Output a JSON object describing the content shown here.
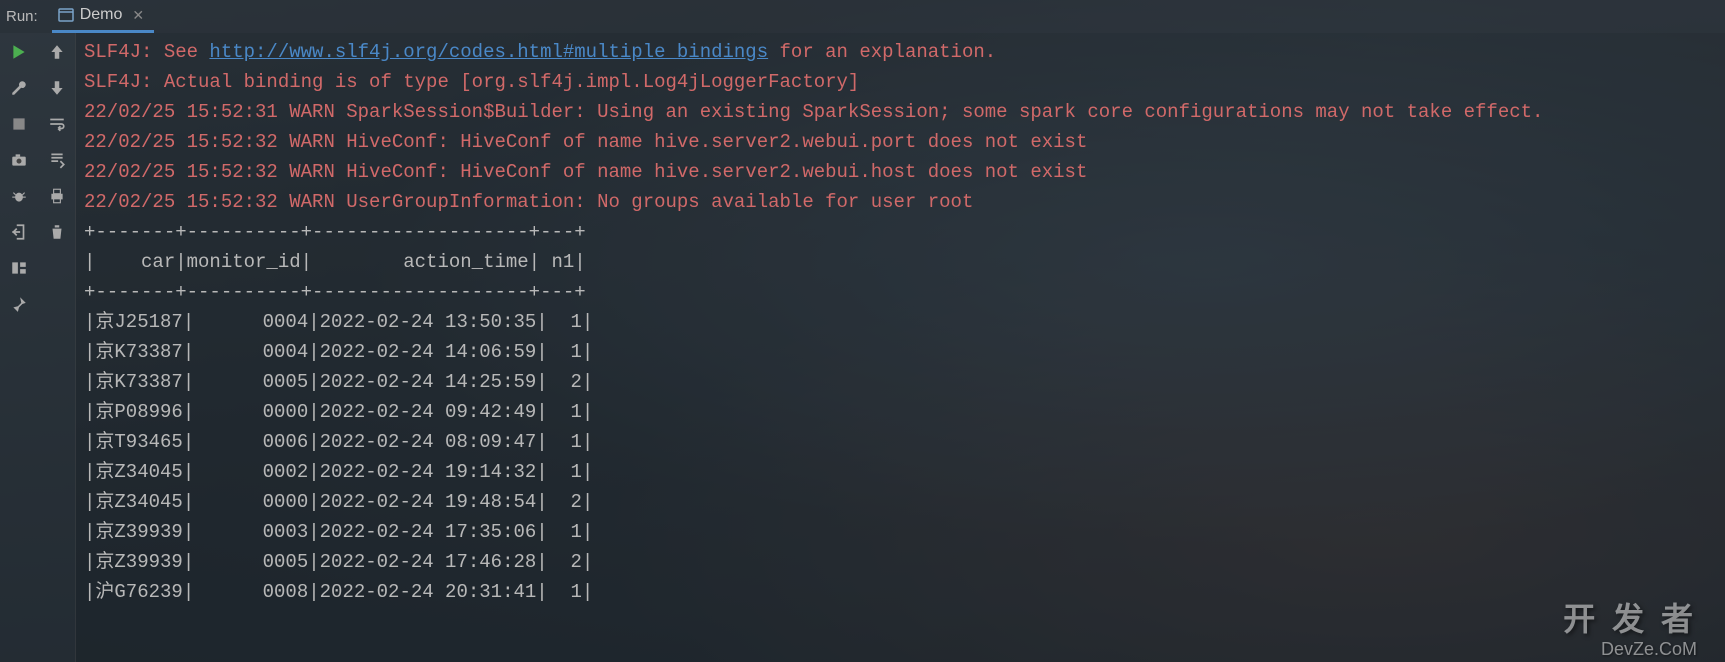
{
  "topbar": {
    "label": "Run:",
    "tab": {
      "name": "Demo"
    }
  },
  "sidebar1": {
    "run": "run",
    "wrench": "wrench",
    "stop": "stop",
    "camera": "camera",
    "bug": "bug",
    "exit": "exit",
    "layout": "layout",
    "pin": "pin"
  },
  "sidebar2": {
    "up": "up",
    "down": "down",
    "wrap": "wrap",
    "scroll": "scroll",
    "print": "print",
    "trash": "trash"
  },
  "console": {
    "log_prefix_1": "SLF4J: See ",
    "log_link_1": "http://www.slf4j.org/codes.html#multiple_bindings",
    "log_suffix_1": " for an explanation.",
    "log_2": "SLF4J: Actual binding is of type [org.slf4j.impl.Log4jLoggerFactory]",
    "log_3": "22/02/25 15:52:31 WARN SparkSession$Builder: Using an existing SparkSession; some spark core configurations may not take effect.",
    "log_4": "22/02/25 15:52:32 WARN HiveConf: HiveConf of name hive.server2.webui.port does not exist",
    "log_5": "22/02/25 15:52:32 WARN HiveConf: HiveConf of name hive.server2.webui.host does not exist",
    "log_6": "22/02/25 15:52:32 WARN UserGroupInformation: No groups available for user root",
    "sep": "+-------+----------+-------------------+---+",
    "header": "|    car|monitor_id|        action_time| n1|",
    "rows": [
      "|京J25187|      0004|2022-02-24 13:50:35|  1|",
      "|京K73387|      0004|2022-02-24 14:06:59|  1|",
      "|京K73387|      0005|2022-02-24 14:25:59|  2|",
      "|京P08996|      0000|2022-02-24 09:42:49|  1|",
      "|京T93465|      0006|2022-02-24 08:09:47|  1|",
      "|京Z34045|      0002|2022-02-24 19:14:32|  1|",
      "|京Z34045|      0000|2022-02-24 19:48:54|  2|",
      "|京Z39939|      0003|2022-02-24 17:35:06|  1|",
      "|京Z39939|      0005|2022-02-24 17:46:28|  2|",
      "|沪G76239|      0008|2022-02-24 20:31:41|  1|"
    ]
  },
  "watermark": {
    "main": "开 发 者",
    "sub": "DevZe.CoM"
  },
  "chart_data": {
    "type": "table",
    "columns": [
      "car",
      "monitor_id",
      "action_time",
      "n1"
    ],
    "rows": [
      [
        "京J25187",
        "0004",
        "2022-02-24 13:50:35",
        1
      ],
      [
        "京K73387",
        "0004",
        "2022-02-24 14:06:59",
        1
      ],
      [
        "京K73387",
        "0005",
        "2022-02-24 14:25:59",
        2
      ],
      [
        "京P08996",
        "0000",
        "2022-02-24 09:42:49",
        1
      ],
      [
        "京T93465",
        "0006",
        "2022-02-24 08:09:47",
        1
      ],
      [
        "京Z34045",
        "0002",
        "2022-02-24 19:14:32",
        1
      ],
      [
        "京Z34045",
        "0000",
        "2022-02-24 19:48:54",
        2
      ],
      [
        "京Z39939",
        "0003",
        "2022-02-24 17:35:06",
        1
      ],
      [
        "京Z39939",
        "0005",
        "2022-02-24 17:46:28",
        2
      ],
      [
        "沪G76239",
        "0008",
        "2022-02-24 20:31:41",
        1
      ]
    ]
  }
}
